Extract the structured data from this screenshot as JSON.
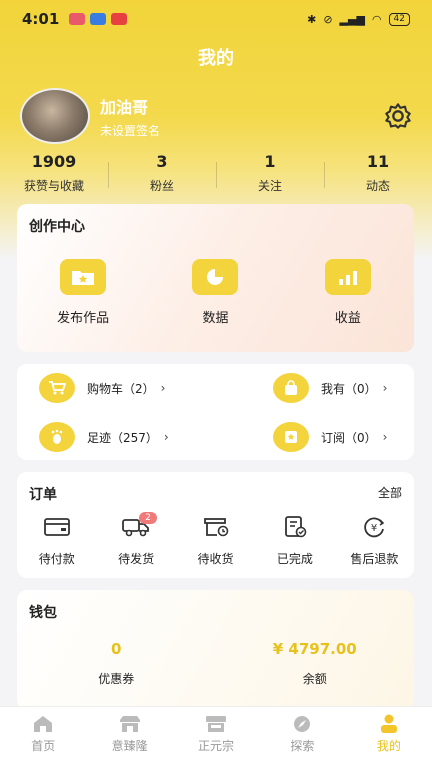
{
  "status_bar": {
    "time": "4:01",
    "battery": "42"
  },
  "header": {
    "title": "我的"
  },
  "profile": {
    "name": "加油哥",
    "signature": "未设置签名"
  },
  "stats": [
    {
      "value": "1909",
      "label": "获赞与收藏"
    },
    {
      "value": "3",
      "label": "粉丝"
    },
    {
      "value": "1",
      "label": "关注"
    },
    {
      "value": "11",
      "label": "动态"
    }
  ],
  "creation_center": {
    "title": "创作中心",
    "items": [
      {
        "label": "发布作品",
        "icon": "folder-star-icon"
      },
      {
        "label": "数据",
        "icon": "pie-chart-icon"
      },
      {
        "label": "收益",
        "icon": "bar-chart-icon"
      }
    ]
  },
  "shortcuts": {
    "cart": "购物车（2）",
    "own": "我有（0）",
    "footprint": "足迹（257）",
    "subscribe": "订阅（0）"
  },
  "orders": {
    "title": "订单",
    "all_label": "全部",
    "items": [
      {
        "label": "待付款",
        "icon": "wallet-icon"
      },
      {
        "label": "待发货",
        "icon": "truck-icon",
        "badge": "2"
      },
      {
        "label": "待收货",
        "icon": "box-clock-icon"
      },
      {
        "label": "已完成",
        "icon": "doc-check-icon"
      },
      {
        "label": "售后退款",
        "icon": "refund-icon"
      }
    ]
  },
  "wallet": {
    "title": "钱包",
    "items": [
      {
        "value": "0",
        "label": "优惠券"
      },
      {
        "value": "¥ 4797.00",
        "label": "余额"
      }
    ]
  },
  "tabbar": [
    {
      "label": "首页",
      "icon": "home-icon"
    },
    {
      "label": "意臻隆",
      "icon": "shop-icon"
    },
    {
      "label": "正元宗",
      "icon": "store-icon"
    },
    {
      "label": "探索",
      "icon": "compass-icon"
    },
    {
      "label": "我的",
      "icon": "user-icon",
      "active": true
    }
  ],
  "colors": {
    "brand_yellow": "#f4d43c",
    "accent_gold": "#e7c21c",
    "badge_red": "#f07a7a"
  }
}
